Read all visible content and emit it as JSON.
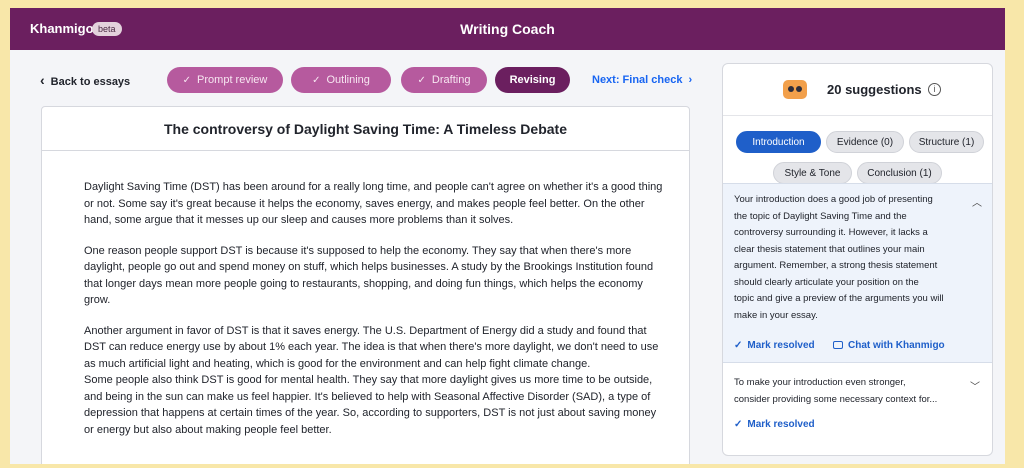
{
  "header": {
    "brand": "Khanmigo",
    "badge": "beta",
    "title": "Writing Coach"
  },
  "nav": {
    "back_label": "Back to essays",
    "steps": [
      {
        "label": "Prompt review",
        "state": "done"
      },
      {
        "label": "Outlining",
        "state": "done"
      },
      {
        "label": "Drafting",
        "state": "done"
      },
      {
        "label": "Revising",
        "state": "active"
      }
    ],
    "next_label": "Next: Final check"
  },
  "document": {
    "title": "The controversy of Daylight Saving Time: A Timeless Debate",
    "paragraphs": [
      "Daylight Saving Time (DST) has been around for a really long time, and people can't agree on whether it's a good thing or not. Some say it's great because it helps the economy, saves energy, and makes people feel better. On the other hand, some argue that it messes up our sleep and causes more problems than it solves.",
      "One reason people support DST is because it's supposed to help the economy. They say that when there's more daylight, people go out and spend money on stuff, which helps businesses. A study by the Brookings Institution found that longer days mean more people going to restaurants, shopping, and doing fun things, which helps the economy grow.",
      "Another argument in favor of DST is that it saves energy. The U.S. Department of Energy did a study and found that DST can reduce energy use by about 1% each year. The idea is that when there's more daylight, we don't need to use as much artificial light and heating, which is good for the environment and can help fight climate change.",
      "Some people also think DST is good for mental health. They say that more daylight gives us more time to be outside, and being in the sun can make us feel happier. It's believed to help with Seasonal Affective Disorder (SAD), a type of depression that happens at certain times of the year. So, according to supporters, DST is not just about saving money or energy but also about making people feel better."
    ]
  },
  "panel": {
    "count_label": "20 suggestions",
    "info_icon": "info-icon",
    "filters": [
      {
        "label": "Introduction",
        "selected": true
      },
      {
        "label": "Evidence (0)",
        "selected": false
      },
      {
        "label": "Structure (1)",
        "selected": false
      },
      {
        "label": "Style & Tone",
        "selected": false
      },
      {
        "label": "Conclusion (1)",
        "selected": false
      }
    ],
    "suggestions": [
      {
        "lines": [
          "Your introduction does a good job of presenting",
          "the topic of Daylight Saving Time and the",
          "controversy surrounding it. However, it lacks a",
          "clear thesis statement that outlines your main",
          "argument. Remember, a strong thesis statement",
          "should clearly articulate your position on the",
          "topic and give a preview of the arguments you will",
          "make in your essay."
        ],
        "mark_resolved": "Mark resolved",
        "chat": "Chat with Khanmigo"
      },
      {
        "lines": [
          "To make your introduction even stronger,",
          "consider providing some necessary context for..."
        ],
        "mark_resolved": "Mark resolved"
      }
    ]
  },
  "colors": {
    "brand_purple": "#6b1f5f",
    "step_done": "#b65a9e",
    "accent_blue": "#1f5fc9",
    "frame_background": "#f8e7a9"
  }
}
